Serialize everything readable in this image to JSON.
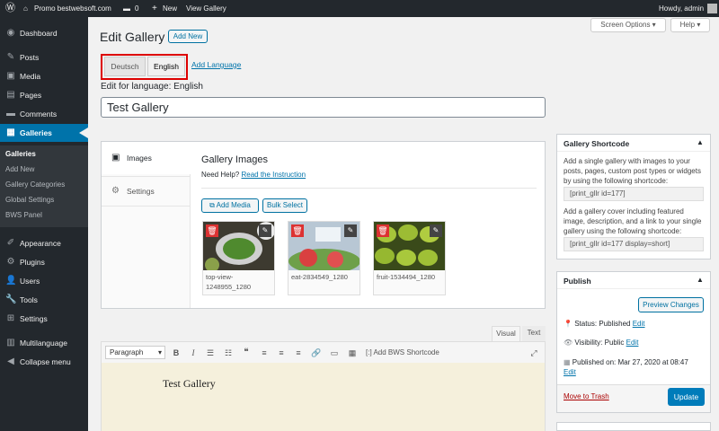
{
  "adminbar": {
    "site_name": "Promo bestwebsoft.com",
    "comments_count": "0",
    "new_label": "New",
    "view_label": "View Gallery",
    "greeting": "Howdy, admin"
  },
  "sidebar": {
    "items": [
      {
        "icon": "dashboard-icon",
        "glyph": "◉",
        "label": "Dashboard"
      },
      {
        "icon": "pin-icon",
        "glyph": "✎",
        "label": "Posts"
      },
      {
        "icon": "media-icon",
        "glyph": "▣",
        "label": "Media"
      },
      {
        "icon": "page-icon",
        "glyph": "▤",
        "label": "Pages"
      },
      {
        "icon": "comment-icon",
        "glyph": "▬",
        "label": "Comments"
      },
      {
        "icon": "gallery-icon",
        "glyph": "▦",
        "label": "Galleries"
      },
      {
        "icon": "appearance-icon",
        "glyph": "✐",
        "label": "Appearance"
      },
      {
        "icon": "plugin-icon",
        "glyph": "⚙",
        "label": "Plugins"
      },
      {
        "icon": "users-icon",
        "glyph": "👤",
        "label": "Users"
      },
      {
        "icon": "tools-icon",
        "glyph": "🔧",
        "label": "Tools"
      },
      {
        "icon": "settings-icon",
        "glyph": "⊞",
        "label": "Settings"
      },
      {
        "icon": "language-icon",
        "glyph": "▥",
        "label": "Multilanguage"
      },
      {
        "icon": "collapse-icon",
        "glyph": "◀",
        "label": "Collapse menu"
      }
    ],
    "subitems": [
      "Galleries",
      "Add New",
      "Gallery Categories",
      "Global Settings",
      "BWS Panel"
    ]
  },
  "header": {
    "title": "Edit Gallery",
    "add_new": "Add New",
    "screen_options": "Screen Options ▾",
    "help": "Help ▾"
  },
  "language": {
    "tabs": [
      "Deutsch",
      "English"
    ],
    "add_language": "Add Language",
    "edit_for": "Edit for language: English"
  },
  "title_input": "Test Gallery",
  "gallery": {
    "side_tabs": [
      "Images",
      "Settings"
    ],
    "heading": "Gallery Images",
    "need_help": "Need Help?",
    "instruction_link": "Read the Instruction",
    "add_media": "Add Media",
    "bulk_select": "Bulk Select",
    "images": [
      {
        "caption": "top-view-\n1248955_1280"
      },
      {
        "caption": "eat-2834549_1280"
      },
      {
        "caption": "fruit-1534494_1280"
      }
    ]
  },
  "editor": {
    "tab_visual": "Visual",
    "tab_text": "Text",
    "format_select": "Paragraph",
    "bws_shortcode": "Add BWS Shortcode",
    "content": "Test Gallery"
  },
  "shortcode_box": {
    "title": "Gallery Shortcode",
    "desc1": "Add a single gallery with images to your posts, pages, custom post types or widgets by using the following shortcode:",
    "code1": "[print_gllr id=177]",
    "desc2": "Add a gallery cover including featured image, description, and a link to your single gallery using the following shortcode:",
    "code2": "[print_gllr id=177 display=short]"
  },
  "publish_box": {
    "title": "Publish",
    "preview": "Preview Changes",
    "status_label": "Status:",
    "status_value": "Published",
    "visibility_label": "Visibility:",
    "visibility_value": "Public",
    "published_label": "Published on:",
    "published_value": "Mar 27, 2020 at 08:47",
    "edit": "Edit",
    "trash": "Move to Trash",
    "update": "Update"
  },
  "colors": {
    "admin_bg": "#23282d",
    "accent": "#0073aa",
    "highlight": "#dd0000",
    "delete": "#dc3232"
  }
}
